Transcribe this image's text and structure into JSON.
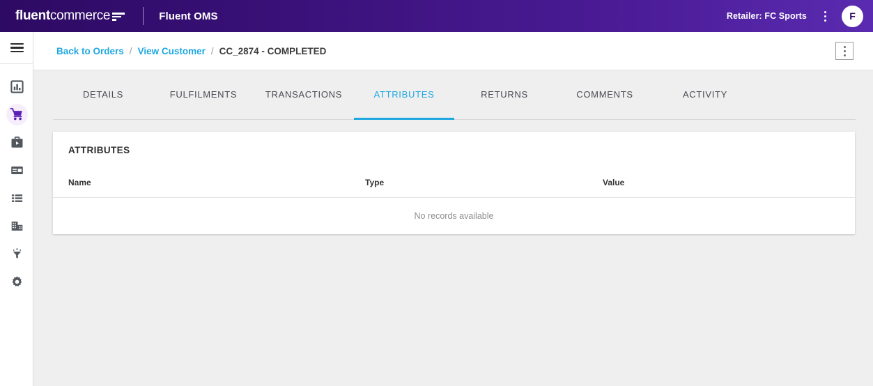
{
  "topbar": {
    "logo_bold": "fluent",
    "logo_light": "commerce",
    "logo_mark_icon": "fluent-lines-mark-icon",
    "app_title": "Fluent OMS",
    "retailer_label": "Retailer: FC Sports",
    "kebab_icon": "more-vertical-icon",
    "avatar_initial": "F",
    "gradient_start": "#2d0a63",
    "gradient_end": "#5a2bb0"
  },
  "sidebar": {
    "hamburger_icon": "hamburger-menu-icon",
    "items": [
      {
        "icon": "bar-chart-icon",
        "name": "sidebar-item-dashboard",
        "active": false
      },
      {
        "icon": "shopping-cart-icon",
        "name": "sidebar-item-orders",
        "active": true
      },
      {
        "icon": "briefcase-play-icon",
        "name": "sidebar-item-jobs",
        "active": false
      },
      {
        "icon": "card-layout-icon",
        "name": "sidebar-item-inventory",
        "active": false
      },
      {
        "icon": "list-icon",
        "name": "sidebar-item-catalogue",
        "active": false
      },
      {
        "icon": "building-icon",
        "name": "sidebar-item-locations",
        "active": false
      },
      {
        "icon": "funnel-icon",
        "name": "sidebar-item-rules",
        "active": false
      },
      {
        "icon": "gear-icon",
        "name": "sidebar-item-settings",
        "active": false
      }
    ],
    "active_accent": "#5b21b6",
    "active_bg": "#f7eefd"
  },
  "breadcrumb": {
    "back_to_orders": "Back to Orders",
    "separator": "/",
    "view_customer": "View Customer",
    "current": "CC_2874 - COMPLETED",
    "link_color": "#1fa8e0",
    "action_icon": "more-vertical-icon"
  },
  "tabs": {
    "active_color": "#1fa8e0",
    "items": [
      {
        "label": "DETAILS",
        "active": false
      },
      {
        "label": "FULFILMENTS",
        "active": false
      },
      {
        "label": "TRANSACTIONS",
        "active": false
      },
      {
        "label": "ATTRIBUTES",
        "active": true
      },
      {
        "label": "RETURNS",
        "active": false
      },
      {
        "label": "COMMENTS",
        "active": false
      },
      {
        "label": "ACTIVITY",
        "active": false
      }
    ]
  },
  "card": {
    "title": "ATTRIBUTES",
    "columns": [
      "Name",
      "Type",
      "Value"
    ],
    "rows": [],
    "empty_message": "No records available"
  }
}
